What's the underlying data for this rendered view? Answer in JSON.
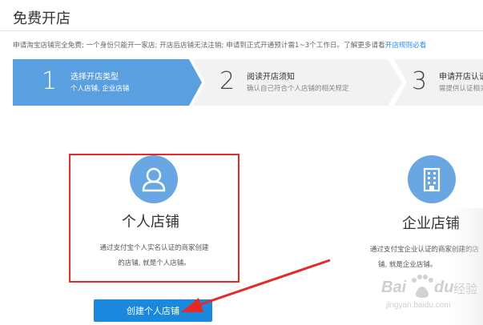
{
  "page": {
    "title": "免费开店",
    "notice_text": "申请淘宝店铺完全免费; 一个身份只能开一家店; 开店后店铺无法注销; 申请到正式开通预计需1~3个工作日。了解更多请看",
    "notice_link": "开店规则必看"
  },
  "steps": [
    {
      "number": "1",
      "title": "选择开店类型",
      "subtitle": "个人店铺, 企业店铺",
      "state": "active"
    },
    {
      "number": "2",
      "title": "阅读开店须知",
      "subtitle": "确认自己符合个人店铺的相关规定",
      "state": "inactive"
    },
    {
      "number": "3",
      "title": "申请开店认证",
      "subtitle": "需提供认证相关资料",
      "state": "inactive"
    }
  ],
  "cards": {
    "personal": {
      "title": "个人店铺",
      "desc_line1": "通过支付宝个人实名认证的商家创建",
      "desc_line2": "的店铺, 就是个人店铺。",
      "button": "创建个人店铺",
      "icon": "person-icon"
    },
    "enterprise": {
      "title": "企业店铺",
      "desc_line1": "通过支付宝企业认证的商家创建的店",
      "desc_line2": "铺, 就是企业店铺。",
      "icon": "building-icon"
    }
  },
  "watermark": {
    "brand": "Bai",
    "brand_suffix": "du",
    "label": "经验",
    "url": "jingyan.baidu.com"
  },
  "colors": {
    "step_active": "#5aa0e0",
    "step_inactive": "#f2f2f2",
    "icon_circle": "#69a7e3",
    "button": "#1a88dc",
    "highlight": "#e52a2a",
    "link": "#2d8cf0"
  }
}
